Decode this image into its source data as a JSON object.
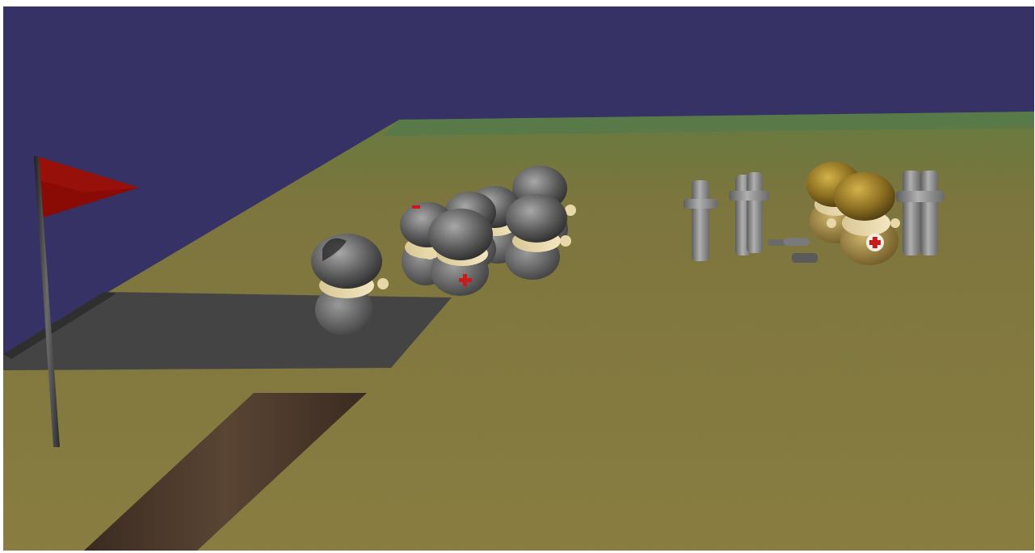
{
  "scene": {
    "kind": "3d-strategy-game-viewport",
    "colors": {
      "sky": "#363266",
      "ground": "#857a3a",
      "ground_far": "#6f7a3a",
      "plaza": "#444444",
      "dirt_path": "#4d3a2c",
      "flag": "#8a0a05",
      "pole": "#3b3b3b",
      "helmet_gray": "#5a5a5a",
      "helmet_gold": "#8a6d20",
      "skin": "#e8d7a8",
      "medic_cross": "#cc1a1a",
      "stone_post": "#8c8c8c"
    },
    "icons": [
      "flag-icon",
      "soldier-figure",
      "medic-soldier-figure",
      "stone-post"
    ],
    "units": {
      "gray_soldiers": 7,
      "gold_soldiers": 2,
      "stone_posts": 5
    }
  }
}
